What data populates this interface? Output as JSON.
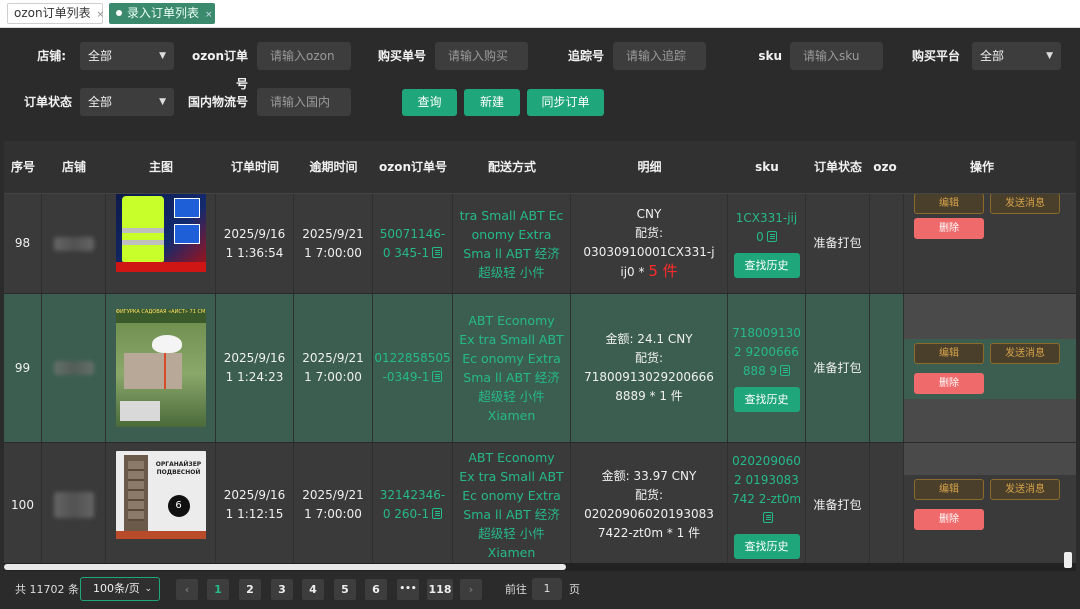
{
  "tabs": [
    {
      "label": "ozon订单列表",
      "close": "×"
    },
    {
      "label": "录入订单列表",
      "close": "×"
    }
  ],
  "filters": {
    "store_label": "店铺:",
    "store_value": "全部",
    "ozon_order_label": "ozon订单号",
    "ozon_order_placeholder": "请输入ozon",
    "purchase_no_label": "购买单号",
    "purchase_no_placeholder": "请输入购买",
    "tracking_label": "追踪号",
    "tracking_placeholder": "请输入追踪",
    "sku_label": "sku",
    "sku_placeholder": "请输入sku",
    "platform_label": "购买平台",
    "platform_value": "全部",
    "status_label": "订单状态",
    "status_value": "全部",
    "domestic_label": "国内物流号",
    "domestic_placeholder": "请输入国内",
    "query_button": "查询",
    "new_button": "新建",
    "sync_button": "同步订单"
  },
  "columns": [
    "序号",
    "店铺",
    "主图",
    "订单时间",
    "逾期时间",
    "ozon订单号",
    "配送方式",
    "明细",
    "sku",
    "订单状态",
    "ozo",
    "操作"
  ],
  "rows": [
    {
      "index": "98",
      "order_time": "2025/9/16 1 1:36:54",
      "due_time": "2025/9/21 1 7:00:00",
      "ozon_order": "50071146-0 345-1",
      "shipping": "tra Small ABT Ec onomy Extra Sma ll ABT 经济超级轻 小件",
      "detail_line1": "CNY",
      "detail_line2": "配货: 03030910001CX331-j ij0 *",
      "detail_qty_highlight": "5 件",
      "sku": "1CX331-jij0",
      "history_button": "查找历史",
      "status": "准备打包",
      "edit": "编辑",
      "msg": "发送消息",
      "del": "删除"
    },
    {
      "index": "99",
      "order_time": "2025/9/16 1 1:24:23",
      "due_time": "2025/9/21 1 7:00:00",
      "ozon_order": "0122858505 -0349-1",
      "shipping": "ABT Economy Ex tra Small ABT Ec onomy Extra Sma ll ABT 经济超级轻 小件 Xiamen",
      "detail_line1": "金额: 24.1 CNY",
      "detail_line2": "配货: 71800913029200666 8889 * 1 件",
      "sku": "7180091302 9200666888 9",
      "history_button": "查找历史",
      "status": "准备打包",
      "edit": "编辑",
      "msg": "发送消息",
      "del": "删除"
    },
    {
      "index": "100",
      "order_time": "2025/9/16 1 1:12:15",
      "due_time": "2025/9/21 1 7:00:00",
      "ozon_order": "32142346-0 260-1",
      "shipping": "ABT Economy Ex tra Small ABT Ec onomy Extra Sma ll ABT 经济超级轻 小件 Xiamen",
      "detail_line1": "金额: 33.97 CNY",
      "detail_line2": "配货: 02020906020193083 7422-zt0m * 1 件",
      "sku": "0202090602 0193083742 2-zt0m",
      "history_button": "查找历史",
      "status": "准备打包",
      "edit": "编辑",
      "msg": "发送消息",
      "del": "删除"
    }
  ],
  "image_texts": {
    "stork_caption": "ФИГУРКА САДОВАЯ «АИСТ» 71 СМ",
    "organizer_caption": "ОРГАНАЙЗЕР ПОДВЕСНОЙ"
  },
  "pagination": {
    "total": "共 11702 条",
    "page_size": "100条/页",
    "pages": [
      "1",
      "2",
      "3",
      "4",
      "5",
      "6",
      "•••",
      "118"
    ],
    "goto_label": "前往",
    "goto_value": "1",
    "page_suffix": "页"
  }
}
